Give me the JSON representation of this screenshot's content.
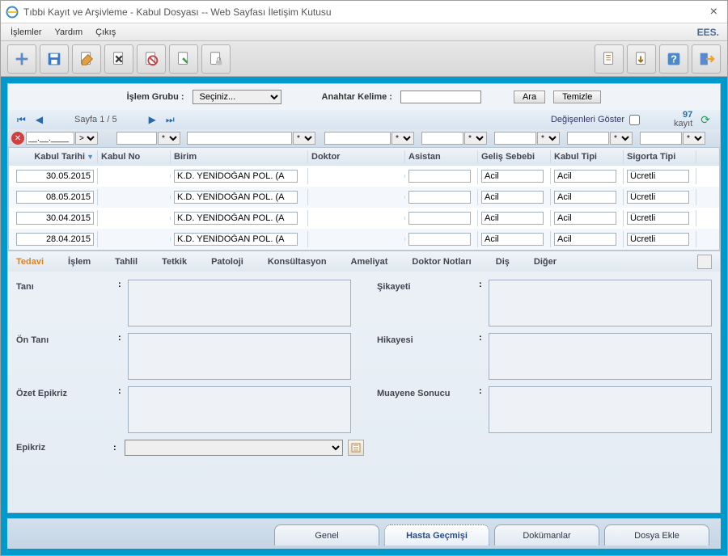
{
  "window": {
    "title": "Tıbbi Kayıt ve Arşivleme - Kabul Dosyası -- Web Sayfası İletişim Kutusu"
  },
  "menu": {
    "items": [
      "İşlemler",
      "Yardım",
      "Çıkış"
    ],
    "brand": "EES."
  },
  "toolbar": {
    "icons": [
      "new",
      "save",
      "edit",
      "delete",
      "cancel",
      "mark",
      "lock"
    ],
    "right_icons": [
      "report",
      "export",
      "help",
      "exit"
    ]
  },
  "search": {
    "group_label": "İşlem Grubu :",
    "group_placeholder": "Seçiniz...",
    "keyword_label": "Anahtar Kelime :",
    "search_btn": "Ara",
    "clear_btn": "Temizle"
  },
  "pager": {
    "page_info": "Sayfa 1 / 5",
    "show_changes": "Değişenleri Göster",
    "count_num": "97",
    "count_label": "kayıt"
  },
  "filter": {
    "date_value": "__.__.____",
    "operator": ">=",
    "star": "*"
  },
  "grid": {
    "headers": {
      "date": "Kabul Tarihi",
      "no": "Kabul No",
      "birim": "Birim",
      "doktor": "Doktor",
      "asistan": "Asistan",
      "gelis": "Geliş Sebebi",
      "tipi": "Kabul Tipi",
      "sigorta": "Sigorta Tipi"
    },
    "rows": [
      {
        "date": "30.05.2015",
        "no": "",
        "birim": "K.D. YENİDOĞAN POL. (A",
        "doktor": "",
        "asistan": "",
        "gelis": "Acil",
        "tipi": "Acil",
        "sigorta": "Ücretli"
      },
      {
        "date": "08.05.2015",
        "no": "",
        "birim": "K.D. YENİDOĞAN POL. (A",
        "doktor": "",
        "asistan": "",
        "gelis": "Acil",
        "tipi": "Acil",
        "sigorta": "Ücretli"
      },
      {
        "date": "30.04.2015",
        "no": "",
        "birim": "K.D. YENİDOĞAN POL. (A",
        "doktor": "",
        "asistan": "",
        "gelis": "Acil",
        "tipi": "Acil",
        "sigorta": "Ücretli"
      },
      {
        "date": "28.04.2015",
        "no": "",
        "birim": "K.D. YENİDOĞAN POL. (A",
        "doktor": "",
        "asistan": "",
        "gelis": "Acil",
        "tipi": "Acil",
        "sigorta": "Ücretli"
      }
    ]
  },
  "tabs": {
    "items": [
      "Tedavi",
      "İşlem",
      "Tahlil",
      "Tetkik",
      "Patoloji",
      "Konsültasyon",
      "Ameliyat",
      "Doktor Notları",
      "Diş",
      "Diğer"
    ],
    "active_index": 0
  },
  "form": {
    "tani": "Tanı",
    "sikayet": "Şikayeti",
    "ontani": "Ön Tanı",
    "hikaye": "Hikayesi",
    "ozet": "Özet Epikriz",
    "muayene": "Muayene Sonucu",
    "epikriz": "Epikriz",
    "colon": ":"
  },
  "bottom_tabs": {
    "items": [
      "Genel",
      "Hasta Geçmişi",
      "Dokümanlar",
      "Dosya Ekle"
    ],
    "active_index": 1
  }
}
